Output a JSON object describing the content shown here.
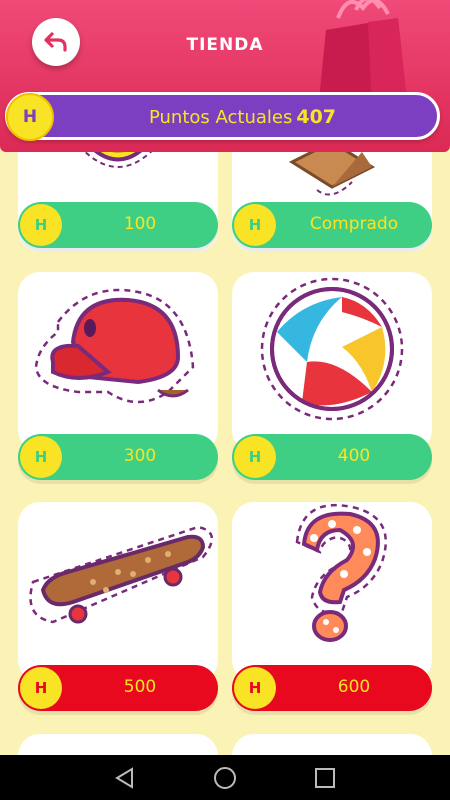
{
  "header": {
    "title": "TIENDA",
    "points_label": "Puntos Actuales",
    "points_value": "407",
    "coin_letter": "H"
  },
  "items": [
    {
      "name": "sun-medal",
      "price": "100",
      "status": "available",
      "color": "#3ecf84"
    },
    {
      "name": "cardboard-box",
      "price": "Comprado",
      "status": "purchased",
      "color": "#3ecf84"
    },
    {
      "name": "red-cap",
      "price": "300",
      "status": "available",
      "color": "#3ecf84"
    },
    {
      "name": "beach-ball",
      "price": "400",
      "status": "available",
      "color": "#3ecf84"
    },
    {
      "name": "skateboard",
      "price": "500",
      "status": "locked",
      "color": "#e8091e"
    },
    {
      "name": "question-mark",
      "price": "600",
      "status": "locked",
      "color": "#e8091e"
    }
  ],
  "colors": {
    "header": "#e2325f",
    "background": "#fbf3b6",
    "points_bar": "#7d3fc2",
    "coin": "#f8e424",
    "affordable": "#3ecf84",
    "unaffordable": "#e8091e"
  },
  "navbar": {
    "icons": [
      "back-triangle-icon",
      "home-circle-icon",
      "recents-square-icon"
    ]
  }
}
